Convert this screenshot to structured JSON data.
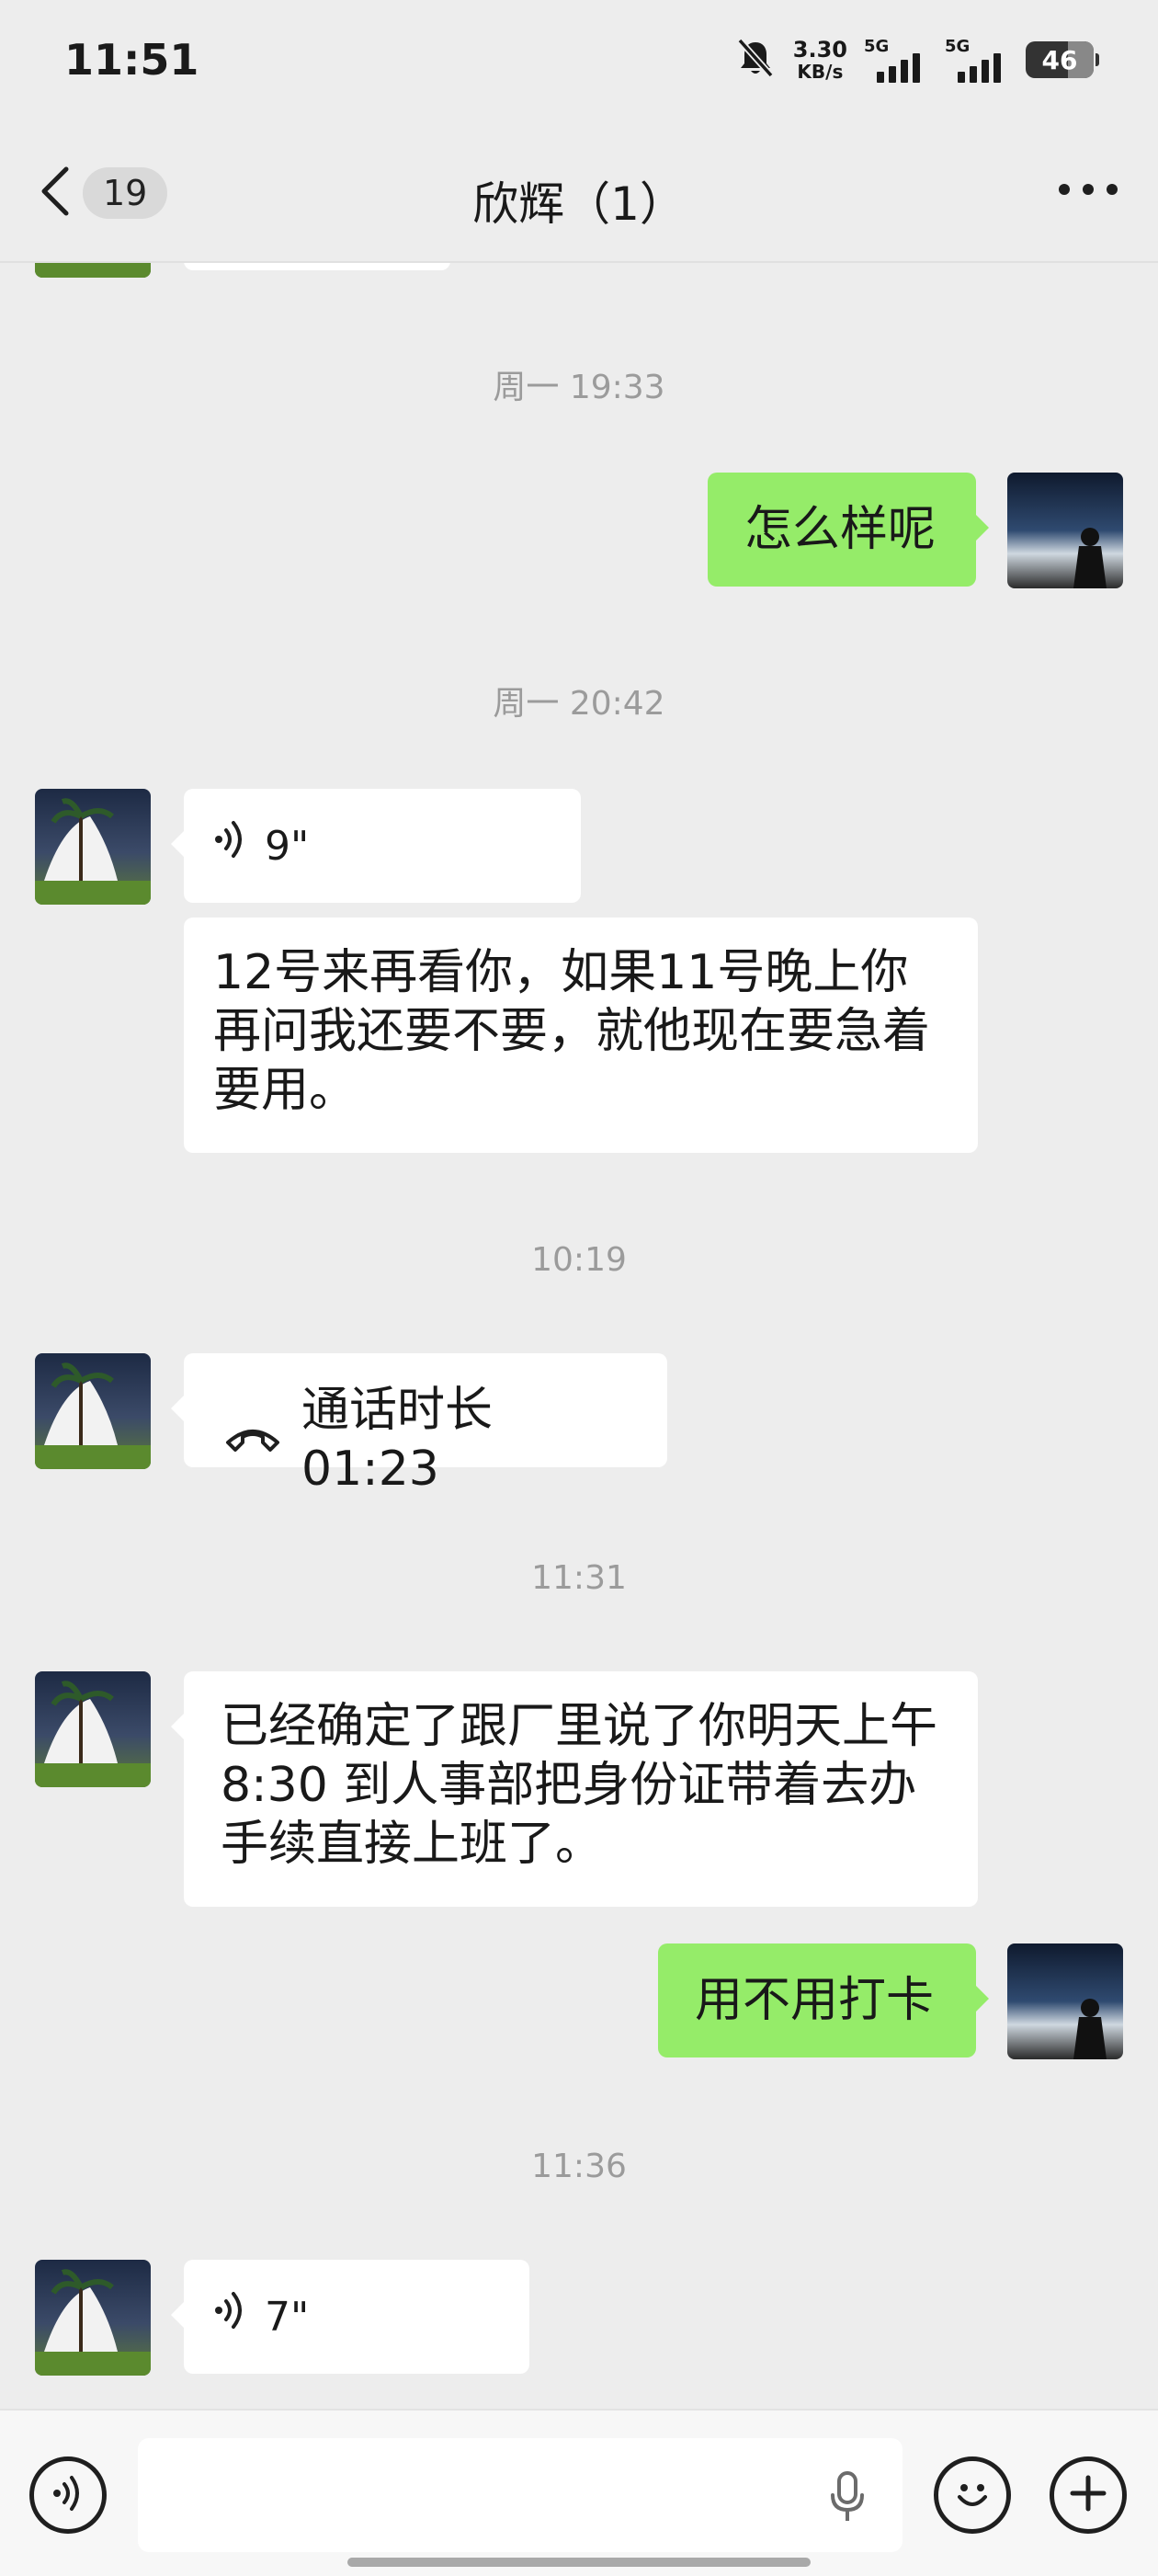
{
  "status_bar": {
    "time": "11:51",
    "net_speed_value": "3.30",
    "net_speed_unit": "KB/s",
    "sim1_label": "5G",
    "sim2_label": "5G",
    "battery_level": "46",
    "icons": [
      "bell-muted-icon",
      "signal-icon",
      "battery-icon"
    ]
  },
  "nav": {
    "unread_count": "19",
    "title": "欣辉（1）",
    "icons": [
      "chevron-left-icon",
      "more-icon"
    ]
  },
  "messages": [
    {
      "type": "time",
      "text": "周一 19:33"
    },
    {
      "type": "text",
      "side": "right",
      "text": "怎么样呢"
    },
    {
      "type": "time",
      "text": "周一 20:42"
    },
    {
      "type": "voice",
      "side": "left",
      "duration": "9\""
    },
    {
      "type": "text",
      "side": "left",
      "text": "12号来再看你，如果11号晚上你再问我还要不要，就他现在要急着要用。"
    },
    {
      "type": "time",
      "text": "10:19"
    },
    {
      "type": "call",
      "side": "left",
      "text": "通话时长 01:23"
    },
    {
      "type": "time",
      "text": "11:31"
    },
    {
      "type": "text",
      "side": "left",
      "text": "已经确定了跟厂里说了你明天上午8:30 到人事部把身份证带着去办手续直接上班了。"
    },
    {
      "type": "text",
      "side": "right",
      "text": "用不用打卡"
    },
    {
      "type": "time",
      "text": "11:36"
    },
    {
      "type": "voice",
      "side": "left",
      "duration": "7\""
    }
  ],
  "input_bar": {
    "placeholder": "",
    "icons": [
      "voice-mode-icon",
      "microphone-icon",
      "emoji-icon",
      "plus-icon"
    ]
  },
  "colors": {
    "background": "#ededed",
    "incoming_bubble": "#ffffff",
    "outgoing_bubble": "#95ec69",
    "timestamp": "#9b9b9b"
  }
}
